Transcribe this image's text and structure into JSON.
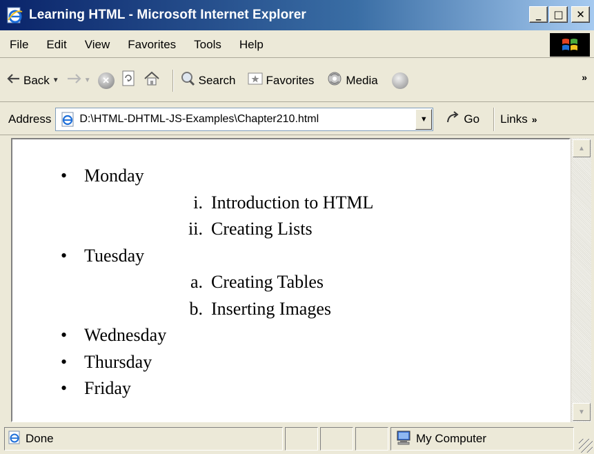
{
  "window": {
    "title": "Learning HTML - Microsoft Internet Explorer",
    "controls": {
      "minimize": "_",
      "maximize": "□",
      "close": "✕"
    }
  },
  "menu": [
    "File",
    "Edit",
    "View",
    "Favorites",
    "Tools",
    "Help"
  ],
  "toolbar": {
    "back": "Back",
    "search": "Search",
    "favorites": "Favorites",
    "media": "Media"
  },
  "address": {
    "label": "Address",
    "value": "D:\\HTML-DHTML-JS-Examples\\Chapter210.html",
    "go": "Go",
    "links": "Links"
  },
  "document": {
    "days": [
      {
        "label": "Monday",
        "sub": [
          {
            "marker": "i.",
            "text": "Introduction to HTML"
          },
          {
            "marker": "ii.",
            "text": "Creating Lists"
          }
        ]
      },
      {
        "label": "Tuesday",
        "sub": [
          {
            "marker": "a.",
            "text": "Creating Tables"
          },
          {
            "marker": "b.",
            "text": "Inserting Images"
          }
        ]
      },
      {
        "label": "Wednesday",
        "sub": []
      },
      {
        "label": "Thursday",
        "sub": []
      },
      {
        "label": "Friday",
        "sub": []
      }
    ]
  },
  "status": {
    "text": "Done",
    "zone": "My Computer"
  },
  "colors": {
    "title_gradient_start": "#0a246a",
    "title_gradient_end": "#a6caf0",
    "chrome": "#ece9d8"
  }
}
